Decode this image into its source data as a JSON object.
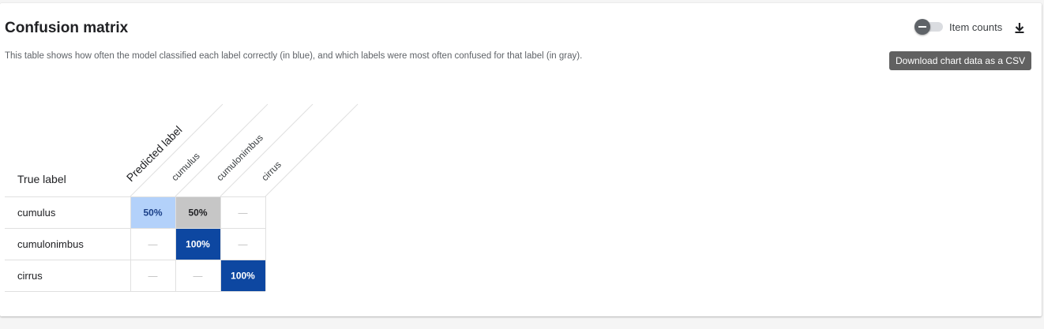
{
  "header": {
    "title": "Confusion matrix",
    "description": "This table shows how often the model classified each label correctly (in blue), and which labels were most often confused for that label (in gray)."
  },
  "controls": {
    "toggle_label": "Item counts",
    "toggle_on": false,
    "download_icon": "download-icon",
    "tooltip": "Download chart data as a CSV"
  },
  "colors": {
    "correct_dark": "#0d47a1",
    "correct_light": "#b3d1fa",
    "confused": "#c6c6c6",
    "grid": "#e0e0e0",
    "empty_text": "#bdbdbd"
  },
  "chart_data": {
    "type": "table",
    "row_axis_label": "True label",
    "column_axis_label": "Predicted label",
    "labels": [
      "cumulus",
      "cumulonimbus",
      "cirrus"
    ],
    "empty_symbol": "—",
    "values": [
      [
        50,
        50,
        null
      ],
      [
        null,
        100,
        null
      ],
      [
        null,
        null,
        100
      ]
    ],
    "unit": "%"
  }
}
